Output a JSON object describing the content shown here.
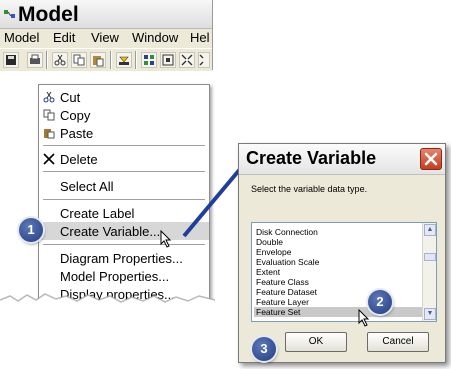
{
  "model_window": {
    "title": "Model",
    "menu": [
      "Model",
      "Edit",
      "View",
      "Window",
      "Hel"
    ],
    "toolbar_icons": [
      "save-icon",
      "print-icon",
      "cut-icon",
      "copy-icon",
      "paste-icon",
      "add-data-icon",
      "grid-icon",
      "full-extent-icon",
      "zoom-in-icon",
      "zoom-out-icon"
    ]
  },
  "context_menu": {
    "items": [
      {
        "label": "Cut",
        "icon": "cut-icon"
      },
      {
        "label": "Copy",
        "icon": "copy-icon"
      },
      {
        "label": "Paste",
        "icon": "paste-icon"
      },
      {
        "label": "Delete",
        "icon": "delete-icon"
      },
      {
        "label": "Select All"
      },
      {
        "label": "Create Label"
      },
      {
        "label": "Create Variable...",
        "highlighted": true
      },
      {
        "label": "Diagram Properties..."
      },
      {
        "label": "Model Properties..."
      },
      {
        "label": "Display properties..."
      }
    ]
  },
  "dialog": {
    "title": "Create Variable",
    "prompt": "Select the variable data type.",
    "list_items": [
      "Disk Connection",
      "Double",
      "Envelope",
      "Evaluation Scale",
      "Extent",
      "Feature Class",
      "Feature Dataset",
      "Feature Layer",
      "Feature Set"
    ],
    "selected": "Feature Set",
    "ok_label": "OK",
    "cancel_label": "Cancel"
  },
  "callouts": [
    "1",
    "2",
    "3"
  ],
  "colors": {
    "badge": "#2b4a8f",
    "arrow": "#1f3f9a",
    "close_button": "#d2522f"
  }
}
